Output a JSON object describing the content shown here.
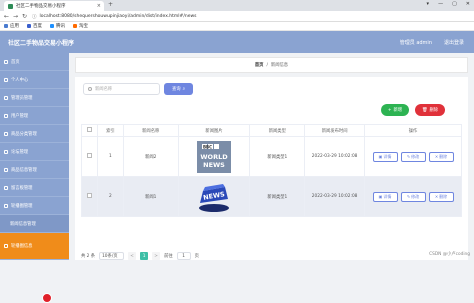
{
  "browser": {
    "tab_title": "社区二手物品交易小程序",
    "tab_close": "×",
    "new_tab": "+",
    "window_controls": [
      "▾",
      "—",
      "▢",
      "✕"
    ],
    "url": "localhost:8080/shequershouwupinjiaoyi/admin/dist/index.html#/news",
    "bookmarks": [
      {
        "label": "应用",
        "color": "#4a7bd0"
      },
      {
        "label": "百度",
        "color": "#3a5fcd"
      },
      {
        "label": "腾讯",
        "color": "#1e90ff"
      },
      {
        "label": "淘宝",
        "color": "#ff6a00"
      }
    ]
  },
  "header": {
    "title": "社区二手物品交易小程序",
    "user": "管理员 admin",
    "logout": "退出登录"
  },
  "sidebar": {
    "items": [
      {
        "label": "首页"
      },
      {
        "label": "个人中心"
      },
      {
        "label": "管理员管理"
      },
      {
        "label": "用户管理"
      },
      {
        "label": "商品分类管理"
      },
      {
        "label": "论坛管理"
      },
      {
        "label": "商品信息管理"
      },
      {
        "label": "留言板管理"
      },
      {
        "label": "轮播图管理"
      },
      {
        "label": "新闻信息管理"
      },
      {
        "label": "轮播图信息"
      }
    ]
  },
  "breadcrumb": {
    "home": "首页",
    "sep": "/",
    "current": "新闻信息"
  },
  "toolbar": {
    "search_placeholder": "新闻名称",
    "search_button": "查询",
    "add_button": "新增",
    "delete_button": "删除"
  },
  "table": {
    "headers": [
      "",
      "索引",
      "新闻名称",
      "新闻图片",
      "新闻类型",
      "新闻发布时间",
      "操作"
    ],
    "rows": [
      {
        "index": "1",
        "name": "新闻2",
        "image": "bbc-world-news",
        "type": "新闻类型1",
        "time": "2022-03-29 10:02:08"
      },
      {
        "index": "2",
        "name": "新闻1",
        "image": "news-button",
        "type": "新闻类型1",
        "time": "2022-03-29 10:02:08"
      }
    ],
    "ops": [
      "详情",
      "修改",
      "删除"
    ],
    "image_text": {
      "bbc": "BBC",
      "world": "WORLD",
      "news": "NEWS",
      "news_btn": "NEWS"
    }
  },
  "pager": {
    "total": "共 2 条",
    "page_size": "10条/页",
    "prev": "<",
    "current": "1",
    "next": ">",
    "goto_label": "前往",
    "goto_value": "1",
    "page_unit": "页"
  },
  "watermark": "CSDN @小卢coding",
  "colors": {
    "header": "#8aa3d1",
    "active": "#f08c1a",
    "primary": "#6f86e0",
    "add": "#2db352",
    "delete": "#e0313a"
  }
}
